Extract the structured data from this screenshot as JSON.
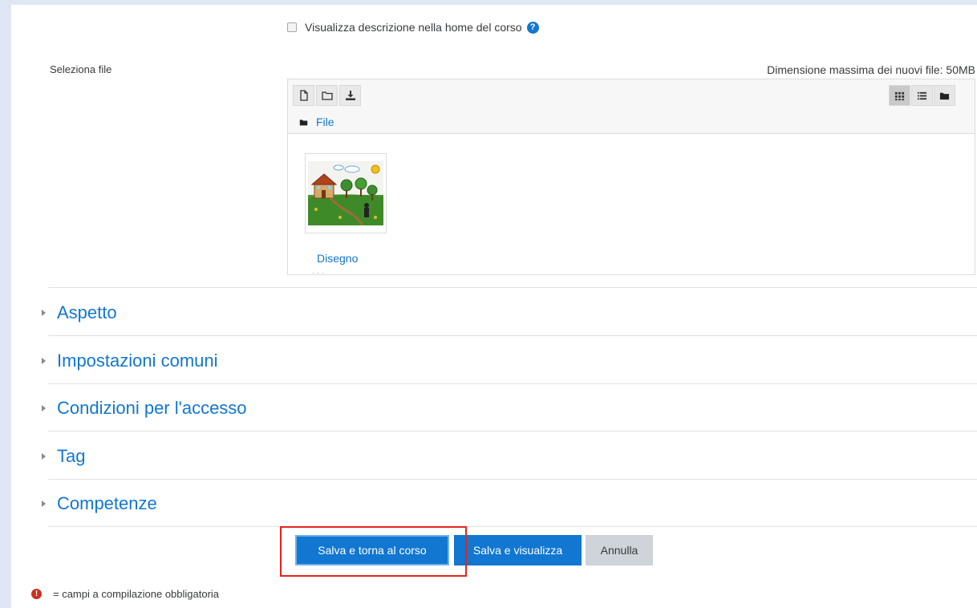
{
  "description_checkbox": {
    "label": "Visualizza descrizione nella home del corso",
    "checked": false
  },
  "file_field": {
    "label": "Seleziona file",
    "max_size": "Dimensione massima dei nuovi file: 50MB",
    "toolbar": {
      "add_icon": "file-icon",
      "mkdir_icon": "folder-icon",
      "download_icon": "download-icon"
    },
    "view_modes": [
      "grid-icon",
      "list-icon",
      "tree-icon"
    ],
    "active_view": "grid-icon",
    "path": "File",
    "files": [
      {
        "name": "Disegno"
      }
    ]
  },
  "sections": [
    {
      "label": "Aspetto"
    },
    {
      "label": "Impostazioni comuni"
    },
    {
      "label": "Condizioni per l'accesso"
    },
    {
      "label": "Tag"
    },
    {
      "label": "Competenze"
    }
  ],
  "buttons": {
    "save_return": "Salva e torna al corso",
    "save_display": "Salva e visualizza",
    "cancel": "Annulla"
  },
  "required_note": "= campi a compilazione obbligatoria",
  "colors": {
    "link": "#1177d1",
    "primary": "#1177d1",
    "highlight": "#e2261a",
    "required": "#ca3120"
  }
}
